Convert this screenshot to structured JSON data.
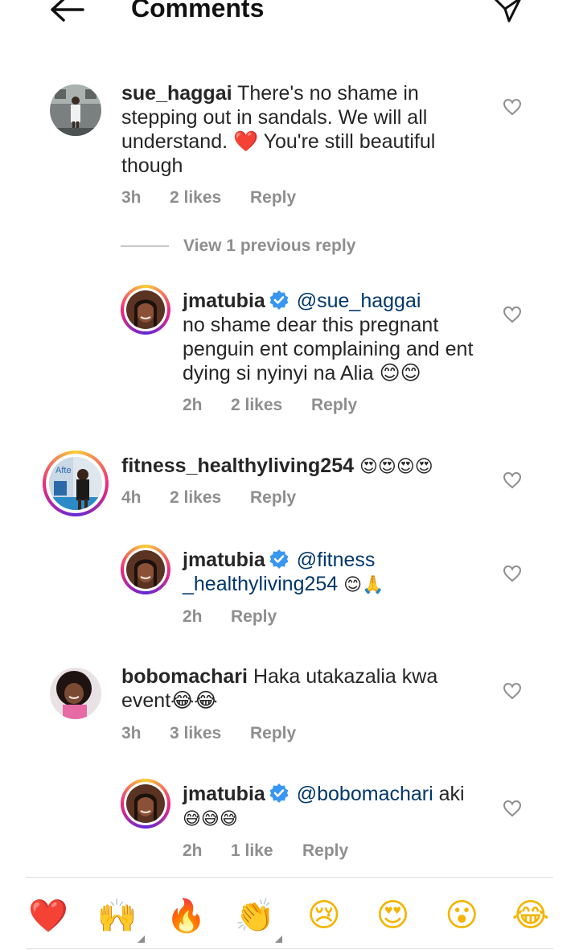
{
  "header": {
    "title": "Comments"
  },
  "colors": {
    "text": "#262626",
    "muted": "#8e8e8e",
    "mention": "#00376b",
    "verified": "#3897f0",
    "heart_red": "#e0245e"
  },
  "comments": [
    {
      "user": "sue_haggai",
      "text": "There's no shame in stepping out in sandals. We will all understand. ❤️ You're still beautiful though",
      "lines": [
        "There's no shame in",
        "stepping out in sandals. We will all",
        "understand. ❤️ You're still beautiful",
        "though"
      ],
      "time": "3h",
      "likes": "2 likes",
      "reply": "Reply"
    },
    {
      "view_replies": "View 1 previous reply"
    },
    {
      "user": "jmatubia",
      "verified": true,
      "mention": "@sue_haggai",
      "lines": [
        "no shame dear this pregnant",
        "penguin ent complaining and ent",
        "dying si nyinyi na Alia 😊😊"
      ],
      "time": "2h",
      "likes": "2 likes",
      "reply": "Reply"
    },
    {
      "user": "fitness_healthyliving254",
      "text": "😍😍😍😍",
      "time": "4h",
      "likes": "2 likes",
      "reply": "Reply"
    },
    {
      "user": "jmatubia",
      "verified": true,
      "mention_lines": [
        "@fitness",
        "_healthyliving254"
      ],
      "text": "😊🙏",
      "time": "2h",
      "reply": "Reply"
    },
    {
      "user": "bobomachari",
      "lines": [
        "Haka utakazalia kwa",
        "event😂😂"
      ],
      "time": "3h",
      "likes": "3 likes",
      "reply": "Reply"
    },
    {
      "user": "jmatubia",
      "verified": true,
      "mention": "@bobomachari",
      "text": "aki",
      "line2": "😅😅😅",
      "time": "2h",
      "likes": "1 like",
      "reply": "Reply"
    }
  ],
  "quick_reactions": [
    "❤️",
    "🙌",
    "🔥",
    "👏",
    "😢",
    "😍",
    "😮",
    "😂"
  ]
}
